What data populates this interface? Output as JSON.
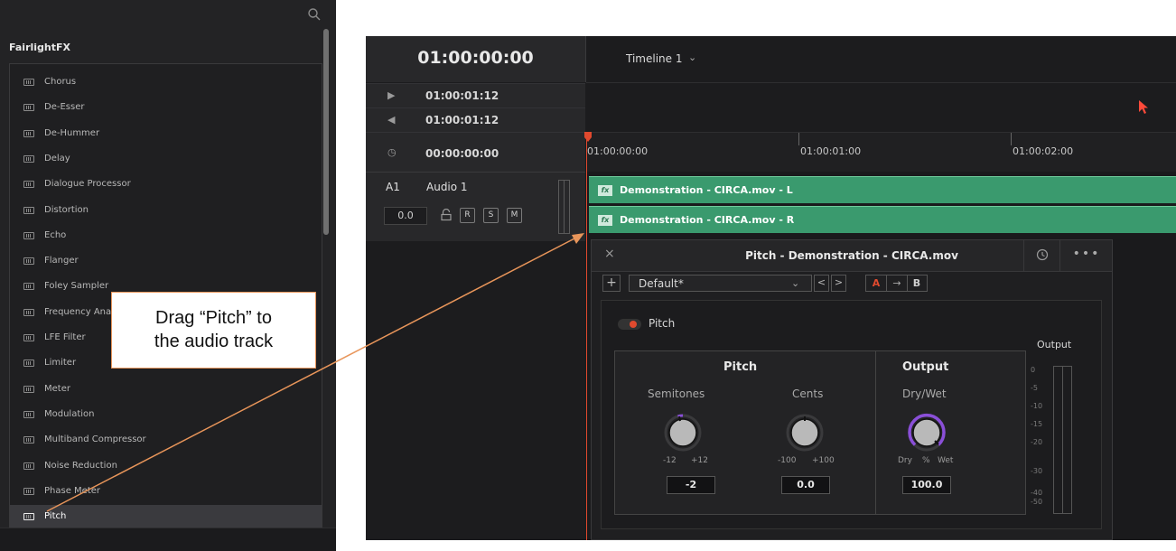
{
  "fx_library": {
    "title": "FairlightFX",
    "items": [
      {
        "label": "Chorus"
      },
      {
        "label": "De-Esser"
      },
      {
        "label": "De-Hummer"
      },
      {
        "label": "Delay"
      },
      {
        "label": "Dialogue Processor"
      },
      {
        "label": "Distortion"
      },
      {
        "label": "Echo"
      },
      {
        "label": "Flanger"
      },
      {
        "label": "Foley Sampler"
      },
      {
        "label": "Frequency Analyzer"
      },
      {
        "label": "LFE Filter"
      },
      {
        "label": "Limiter"
      },
      {
        "label": "Meter"
      },
      {
        "label": "Modulation"
      },
      {
        "label": "Multiband Compressor"
      },
      {
        "label": "Noise Reduction"
      },
      {
        "label": "Phase Meter"
      },
      {
        "label": "Pitch"
      }
    ],
    "selected": "Pitch",
    "search_icon": "search-icon"
  },
  "callout": {
    "line1": "Drag “Pitch” to",
    "line2": "the audio track",
    "border_color": "#e8955a"
  },
  "timecode": {
    "main": "01:00:00:00",
    "rows": [
      {
        "icon": "play-forward-icon",
        "glyph": "▶︎",
        "value": "01:00:01:12"
      },
      {
        "icon": "skip-back-icon",
        "glyph": "◀︎",
        "value": "01:00:01:12"
      },
      {
        "icon": "clock-icon",
        "glyph": "◷",
        "value": "00:00:00:00"
      }
    ]
  },
  "timeline": {
    "name": "Timeline 1",
    "chevron": "⌄",
    "ruler": [
      "01:00:00:00",
      "01:00:01:00",
      "01:00:02:00"
    ],
    "playhead_color": "#e0492e"
  },
  "track": {
    "id": "A1",
    "name": "Audio 1",
    "volume": "0.0",
    "buttons": {
      "r": "R",
      "s": "S",
      "m": "M"
    }
  },
  "clips": [
    {
      "badge": "fx",
      "name": "Demonstration - CIRCA.mov - L"
    },
    {
      "badge": "fx",
      "name": "Demonstration - CIRCA.mov - R"
    }
  ],
  "clip_color": "#3a9a6e",
  "plugin": {
    "close": "×",
    "title": "Pitch - Demonstration - CIRCA.mov",
    "more": "•••",
    "preset_add": "+",
    "preset": "Default*",
    "preset_chev": "⌄",
    "prev": "<",
    "next": ">",
    "ab": {
      "a": "A",
      "arrow": "→",
      "b": "B"
    },
    "toggle_label": "Pitch",
    "sections": {
      "pitch": {
        "title": "Pitch",
        "semitones": {
          "label": "Semitones",
          "min": "-12",
          "max": "+12",
          "value": "-2"
        },
        "cents": {
          "label": "Cents",
          "min": "-100",
          "max": "+100",
          "value": "0.0"
        }
      },
      "output": {
        "title": "Output",
        "drywet": {
          "label": "Dry/Wet",
          "min": "Dry",
          "unit": "%",
          "max": "Wet",
          "value": "100.0"
        }
      }
    },
    "meter": {
      "label": "Output",
      "scale": [
        "0",
        "-5",
        "-10",
        "-15",
        "-20",
        "-30",
        "-40",
        "-50"
      ]
    },
    "knob_accent": "#8a4fd8",
    "toggle_color": "#e04a2e"
  }
}
